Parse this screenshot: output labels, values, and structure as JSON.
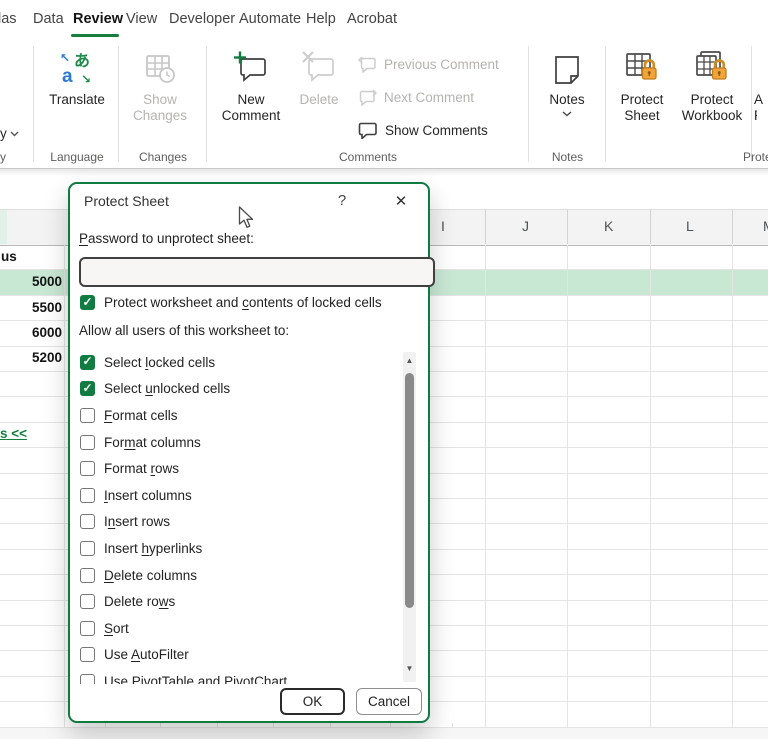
{
  "menu": {
    "tabs": [
      "las",
      "Data",
      "Review",
      "View",
      "Developer",
      "Automate",
      "Help",
      "Acrobat"
    ],
    "active_tab": "Review"
  },
  "ribbon": {
    "partial_left_button": "y",
    "translate": "Translate",
    "show_changes": [
      "Show",
      "Changes"
    ],
    "new_comment": [
      "New",
      "Comment"
    ],
    "delete": "Delete",
    "previous_comment": "Previous Comment",
    "next_comment": "Next Comment",
    "show_comments": "Show Comments",
    "notes": "Notes",
    "protect_sheet": [
      "Protect",
      "Sheet"
    ],
    "protect_workbook": [
      "Protect",
      "Workbook"
    ],
    "partial_right_button": [
      "A",
      "R"
    ],
    "group_labels": [
      "y",
      "Language",
      "Changes",
      "Comments",
      "Notes",
      "Prote"
    ]
  },
  "sheet": {
    "col_headers": [
      "I",
      "J",
      "K",
      "L"
    ],
    "col_header_partial": "M",
    "row_header_fragment": "us",
    "values": [
      "5000",
      "5500",
      "6000",
      "5200"
    ],
    "link_fragment": "s <<"
  },
  "dialog": {
    "title": "Protect Sheet",
    "help_glyph": "?",
    "close_glyph": "✕",
    "password_label": {
      "label": "Password to unprotect sheet:",
      "mn": 0
    },
    "password_value": "",
    "protect_option": {
      "label": "Protect worksheet and contents of locked cells",
      "mn": 22,
      "checked": true
    },
    "allow_label": "Allow all users of this worksheet to:",
    "options": [
      {
        "label": "Select locked cells",
        "mn": 7,
        "checked": true
      },
      {
        "label": "Select unlocked cells",
        "mn": 7,
        "checked": true
      },
      {
        "label": "Format cells",
        "mn": 0,
        "checked": false
      },
      {
        "label": "Format columns",
        "mn": 3,
        "checked": false
      },
      {
        "label": "Format rows",
        "mn": 7,
        "checked": false
      },
      {
        "label": "Insert columns",
        "mn": 0,
        "checked": false
      },
      {
        "label": "Insert rows",
        "mn": 1,
        "checked": false
      },
      {
        "label": "Insert hyperlinks",
        "mn": 7,
        "checked": false
      },
      {
        "label": "Delete columns",
        "mn": 0,
        "checked": false
      },
      {
        "label": "Delete rows",
        "mn": 9,
        "checked": false
      },
      {
        "label": "Sort",
        "mn": 0,
        "checked": false
      },
      {
        "label": "Use AutoFilter",
        "mn": 4,
        "checked": false
      },
      {
        "label": "Use PivotTable and PivotChart",
        "mn": null,
        "checked": false
      }
    ],
    "ok": "OK",
    "cancel": "Cancel"
  },
  "colors": {
    "accent_green": "#107c41",
    "row_highlight": "#c9e8d4",
    "lock_orange": "#f2a33a",
    "disabled_gray": "#b6b3b0"
  }
}
